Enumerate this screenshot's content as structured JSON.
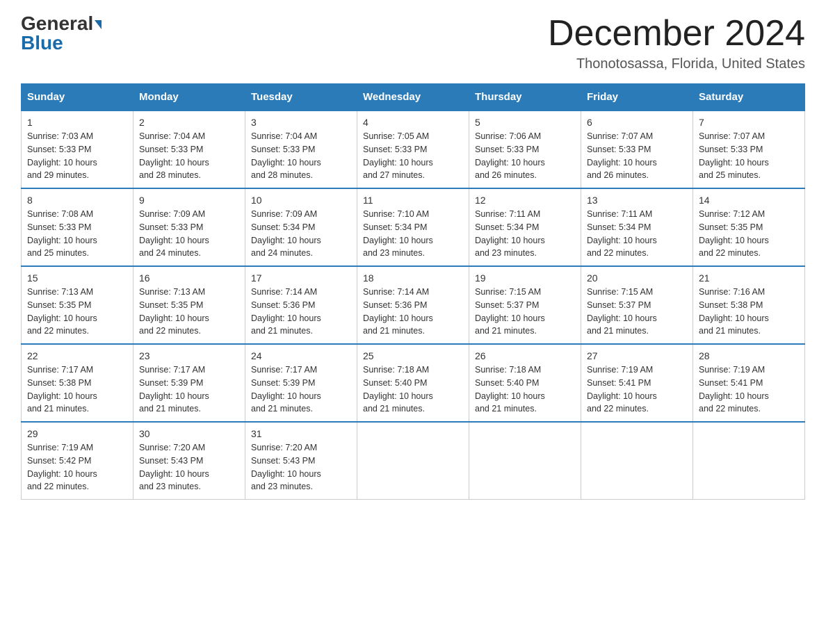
{
  "logo": {
    "general": "General",
    "blue": "Blue"
  },
  "header": {
    "title": "December 2024",
    "subtitle": "Thonotosassa, Florida, United States"
  },
  "days_of_week": [
    "Sunday",
    "Monday",
    "Tuesday",
    "Wednesday",
    "Thursday",
    "Friday",
    "Saturday"
  ],
  "weeks": [
    [
      {
        "day": "1",
        "sunrise": "7:03 AM",
        "sunset": "5:33 PM",
        "daylight": "10 hours and 29 minutes."
      },
      {
        "day": "2",
        "sunrise": "7:04 AM",
        "sunset": "5:33 PM",
        "daylight": "10 hours and 28 minutes."
      },
      {
        "day": "3",
        "sunrise": "7:04 AM",
        "sunset": "5:33 PM",
        "daylight": "10 hours and 28 minutes."
      },
      {
        "day": "4",
        "sunrise": "7:05 AM",
        "sunset": "5:33 PM",
        "daylight": "10 hours and 27 minutes."
      },
      {
        "day": "5",
        "sunrise": "7:06 AM",
        "sunset": "5:33 PM",
        "daylight": "10 hours and 26 minutes."
      },
      {
        "day": "6",
        "sunrise": "7:07 AM",
        "sunset": "5:33 PM",
        "daylight": "10 hours and 26 minutes."
      },
      {
        "day": "7",
        "sunrise": "7:07 AM",
        "sunset": "5:33 PM",
        "daylight": "10 hours and 25 minutes."
      }
    ],
    [
      {
        "day": "8",
        "sunrise": "7:08 AM",
        "sunset": "5:33 PM",
        "daylight": "10 hours and 25 minutes."
      },
      {
        "day": "9",
        "sunrise": "7:09 AM",
        "sunset": "5:33 PM",
        "daylight": "10 hours and 24 minutes."
      },
      {
        "day": "10",
        "sunrise": "7:09 AM",
        "sunset": "5:34 PM",
        "daylight": "10 hours and 24 minutes."
      },
      {
        "day": "11",
        "sunrise": "7:10 AM",
        "sunset": "5:34 PM",
        "daylight": "10 hours and 23 minutes."
      },
      {
        "day": "12",
        "sunrise": "7:11 AM",
        "sunset": "5:34 PM",
        "daylight": "10 hours and 23 minutes."
      },
      {
        "day": "13",
        "sunrise": "7:11 AM",
        "sunset": "5:34 PM",
        "daylight": "10 hours and 22 minutes."
      },
      {
        "day": "14",
        "sunrise": "7:12 AM",
        "sunset": "5:35 PM",
        "daylight": "10 hours and 22 minutes."
      }
    ],
    [
      {
        "day": "15",
        "sunrise": "7:13 AM",
        "sunset": "5:35 PM",
        "daylight": "10 hours and 22 minutes."
      },
      {
        "day": "16",
        "sunrise": "7:13 AM",
        "sunset": "5:35 PM",
        "daylight": "10 hours and 22 minutes."
      },
      {
        "day": "17",
        "sunrise": "7:14 AM",
        "sunset": "5:36 PM",
        "daylight": "10 hours and 21 minutes."
      },
      {
        "day": "18",
        "sunrise": "7:14 AM",
        "sunset": "5:36 PM",
        "daylight": "10 hours and 21 minutes."
      },
      {
        "day": "19",
        "sunrise": "7:15 AM",
        "sunset": "5:37 PM",
        "daylight": "10 hours and 21 minutes."
      },
      {
        "day": "20",
        "sunrise": "7:15 AM",
        "sunset": "5:37 PM",
        "daylight": "10 hours and 21 minutes."
      },
      {
        "day": "21",
        "sunrise": "7:16 AM",
        "sunset": "5:38 PM",
        "daylight": "10 hours and 21 minutes."
      }
    ],
    [
      {
        "day": "22",
        "sunrise": "7:17 AM",
        "sunset": "5:38 PM",
        "daylight": "10 hours and 21 minutes."
      },
      {
        "day": "23",
        "sunrise": "7:17 AM",
        "sunset": "5:39 PM",
        "daylight": "10 hours and 21 minutes."
      },
      {
        "day": "24",
        "sunrise": "7:17 AM",
        "sunset": "5:39 PM",
        "daylight": "10 hours and 21 minutes."
      },
      {
        "day": "25",
        "sunrise": "7:18 AM",
        "sunset": "5:40 PM",
        "daylight": "10 hours and 21 minutes."
      },
      {
        "day": "26",
        "sunrise": "7:18 AM",
        "sunset": "5:40 PM",
        "daylight": "10 hours and 21 minutes."
      },
      {
        "day": "27",
        "sunrise": "7:19 AM",
        "sunset": "5:41 PM",
        "daylight": "10 hours and 22 minutes."
      },
      {
        "day": "28",
        "sunrise": "7:19 AM",
        "sunset": "5:41 PM",
        "daylight": "10 hours and 22 minutes."
      }
    ],
    [
      {
        "day": "29",
        "sunrise": "7:19 AM",
        "sunset": "5:42 PM",
        "daylight": "10 hours and 22 minutes."
      },
      {
        "day": "30",
        "sunrise": "7:20 AM",
        "sunset": "5:43 PM",
        "daylight": "10 hours and 23 minutes."
      },
      {
        "day": "31",
        "sunrise": "7:20 AM",
        "sunset": "5:43 PM",
        "daylight": "10 hours and 23 minutes."
      },
      null,
      null,
      null,
      null
    ]
  ],
  "labels": {
    "sunrise": "Sunrise: ",
    "sunset": "Sunset: ",
    "daylight": "Daylight: "
  }
}
